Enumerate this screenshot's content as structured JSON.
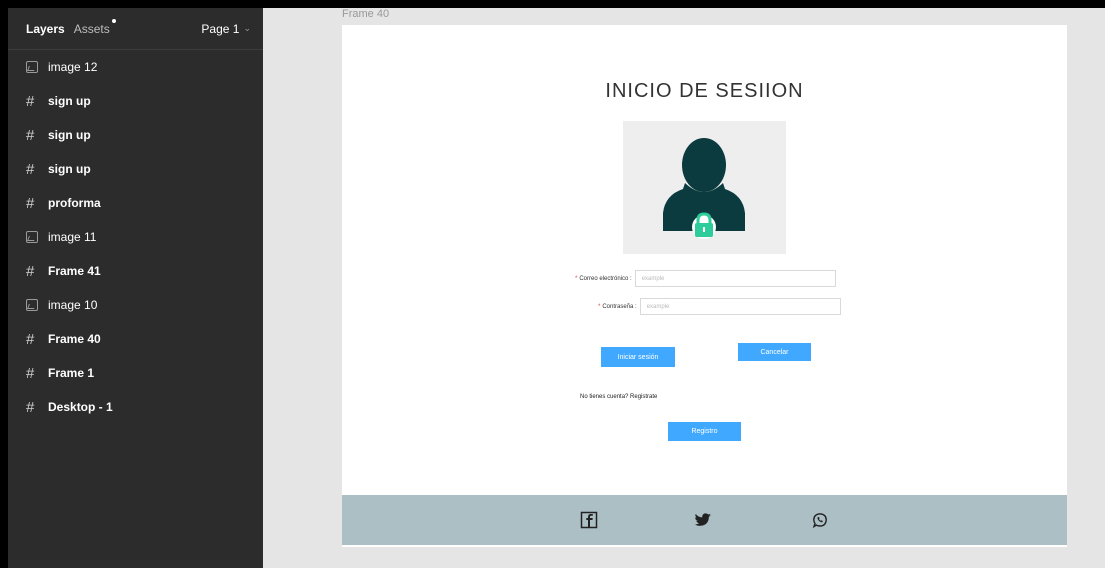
{
  "panel": {
    "tabs": {
      "layers": "Layers",
      "assets": "Assets"
    },
    "page_selector": "Page 1",
    "layers": [
      {
        "label": "image 12",
        "icon": "image-icon"
      },
      {
        "label": "sign up",
        "icon": "frame-hash-icon"
      },
      {
        "label": "sign up",
        "icon": "frame-hash-icon"
      },
      {
        "label": "sign up",
        "icon": "frame-hash-icon"
      },
      {
        "label": "proforma",
        "icon": "frame-hash-icon"
      },
      {
        "label": "image 11",
        "icon": "image-icon"
      },
      {
        "label": "Frame 41",
        "icon": "frame-hash-icon"
      },
      {
        "label": "image 10",
        "icon": "image-icon"
      },
      {
        "label": "Frame 40",
        "icon": "frame-hash-icon"
      },
      {
        "label": "Frame 1",
        "icon": "frame-hash-icon"
      },
      {
        "label": "Desktop - 1",
        "icon": "frame-hash-icon"
      }
    ]
  },
  "canvas": {
    "frame_label": "Frame 40",
    "title": "INICIO DE SESIION",
    "form": {
      "email_label": "Correo electrónico :",
      "email_placeholder": "example",
      "password_label": "Contraseña :",
      "password_placeholder": "example",
      "required_mark": "*"
    },
    "buttons": {
      "login": "Iniciar sesión",
      "cancel": "Cancelar",
      "register": "Registro"
    },
    "no_account_text": "No tienes cuenta? Registrate",
    "social_icons": [
      "facebook-icon",
      "twitter-icon",
      "whatsapp-icon"
    ]
  },
  "colors": {
    "panel_bg": "#2c2c2c",
    "canvas_bg": "#e5e5e5",
    "button_blue": "#40a9ff",
    "footer_bg": "#acbfc5",
    "avatar_dark": "#0b3b3f",
    "lock_green": "#2ecc9a"
  }
}
